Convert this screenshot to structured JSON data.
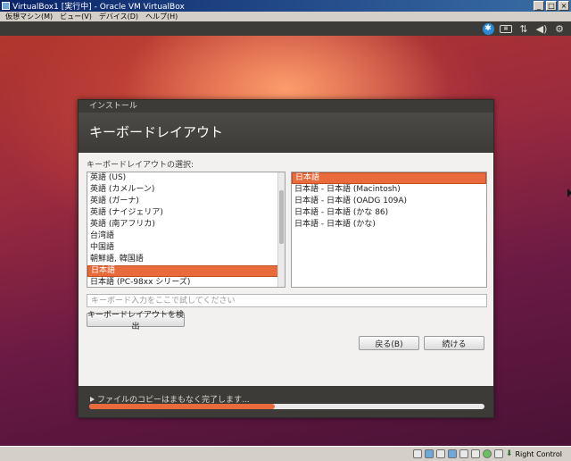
{
  "host": {
    "title": "VirtualBox1 [実行中] - Oracle VM VirtualBox",
    "menu": [
      "仮想マシン(M)",
      "ビュー(V)",
      "デバイス(D)",
      "ヘルプ(H)"
    ],
    "status_text": "Right Control"
  },
  "ubuntu_panel": {
    "icons": [
      "accessibility-icon",
      "keyboard-icon",
      "network-icon",
      "volume-icon",
      "settings-gear-icon"
    ]
  },
  "installer": {
    "window_title": "インストール",
    "heading": "キーボードレイアウト",
    "select_label": "キーボードレイアウトの選択:",
    "layouts": [
      "英語 (US)",
      "英語 (カメルーン)",
      "英語 (ガーナ)",
      "英語 (ナイジェリア)",
      "英語 (南アフリカ)",
      "台湾語",
      "中国語",
      "朝鮮語, 韓国語",
      "日本語",
      "日本語 (PC-98xx シリーズ)"
    ],
    "selected_layout_index": 8,
    "variants": [
      "日本語",
      "日本語 - 日本語 (Macintosh)",
      "日本語 - 日本語 (OADG 109A)",
      "日本語 - 日本語 (かな 86)",
      "日本語 - 日本語 (かな)"
    ],
    "selected_variant_index": 0,
    "test_placeholder": "キーボード入力をここで試してください",
    "test_value": "",
    "detect_button": "キーボードレイアウトを検出",
    "back_button": "戻る(B)",
    "continue_button": "続ける",
    "progress_text": "ファイルのコピーはまもなく完了します...",
    "progress_fraction": 0.47
  },
  "colors": {
    "accent": "#e96a3a",
    "panel": "#3c3b37"
  }
}
